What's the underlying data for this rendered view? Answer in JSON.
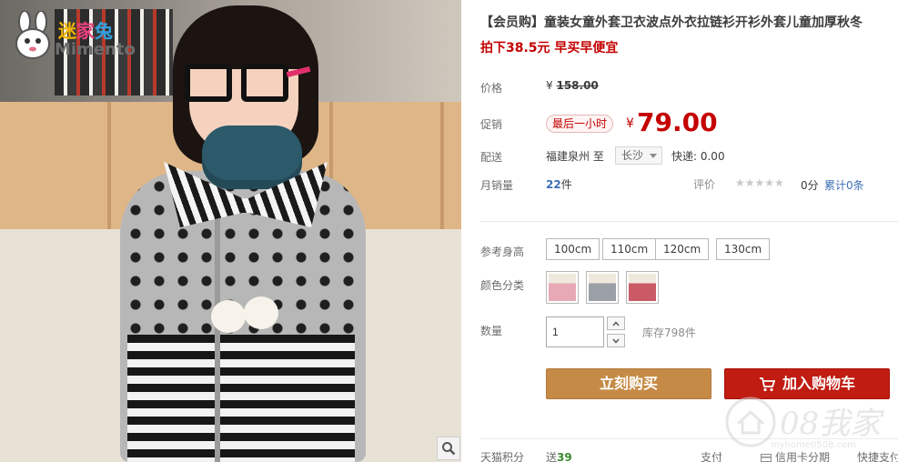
{
  "logo": {
    "top_c1": "迷",
    "top_c2": "家",
    "top_c3": "兔",
    "sub": "Mimento"
  },
  "product": {
    "title": "【会员购】童装女童外套卫衣波点外衣拉链衫开衫外套儿童加厚秋冬",
    "promo": "拍下38.5元 早买早便宜"
  },
  "labels": {
    "price": "价格",
    "promo_price": "促销",
    "shipping": "配送",
    "monthly_sales": "月销量",
    "rating": "评价",
    "height": "参考身高",
    "color": "颜色分类",
    "quantity": "数量"
  },
  "price": {
    "currency": "¥",
    "original": "158.00",
    "tag": "最后一小时",
    "current": "79.00"
  },
  "shipping": {
    "from": "福建泉州 至",
    "dest": "长沙",
    "fee": "快递: 0.00"
  },
  "sales": {
    "count": "22",
    "unit": "件",
    "stars": "★★★★★",
    "score": "0分",
    "review_link": "累计0条"
  },
  "sizes": [
    "100cm",
    "110cm",
    "120cm",
    "130cm"
  ],
  "colors": [
    {
      "name": "pink",
      "hex": "#e7a9b6"
    },
    {
      "name": "grey",
      "hex": "#9aa0a6"
    },
    {
      "name": "red",
      "hex": "#c95a66"
    }
  ],
  "quantity": {
    "value": "1",
    "stock": "库存798件"
  },
  "buttons": {
    "buy_now": "立刻购买",
    "add_to_cart": "加入购物车"
  },
  "footer": {
    "tmall_points_label": "天猫积分",
    "points_prefix": "送",
    "points_value": "39",
    "payment_label": "支付",
    "payment_credit": "信用卡分期",
    "payment_fast": "快捷支付"
  },
  "watermark": {
    "text": "08我家",
    "url": "myhome0508.com"
  },
  "colors_theme": {
    "price_red": "#c40000",
    "buy_btn": "#c58b46",
    "cart_btn": "#c01c12",
    "link_blue": "#3d6fb6"
  }
}
